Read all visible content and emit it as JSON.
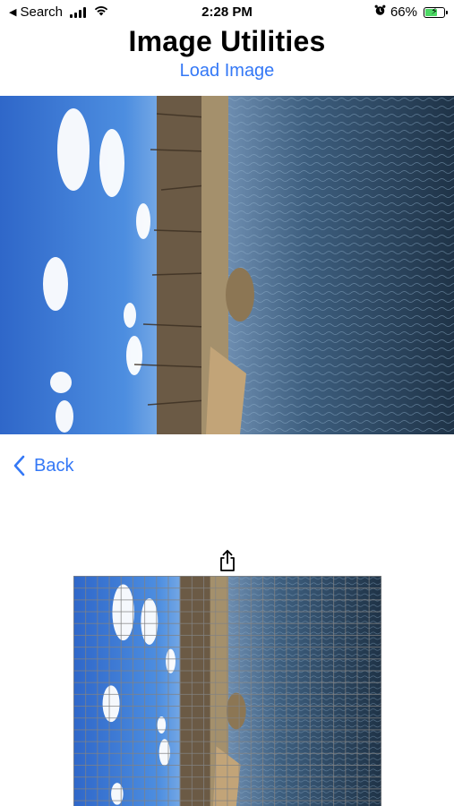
{
  "status_bar": {
    "back_app": "Search",
    "time": "2:28 PM",
    "battery_percent": "66%",
    "battery_level": 0.66,
    "icons": [
      "back-caret-icon",
      "cellular-signal-icon",
      "wifi-icon",
      "alarm-icon",
      "battery-charging-icon"
    ]
  },
  "header": {
    "title": "Image Utilities",
    "load_button": "Load Image"
  },
  "navigation": {
    "back_label": "Back"
  },
  "actions": {
    "share_icon": "share-icon"
  },
  "colors": {
    "accent": "#3478f6",
    "sky": "#3f7fd6",
    "water": "#2e4f6a",
    "battery_fill": "#4cd964"
  }
}
